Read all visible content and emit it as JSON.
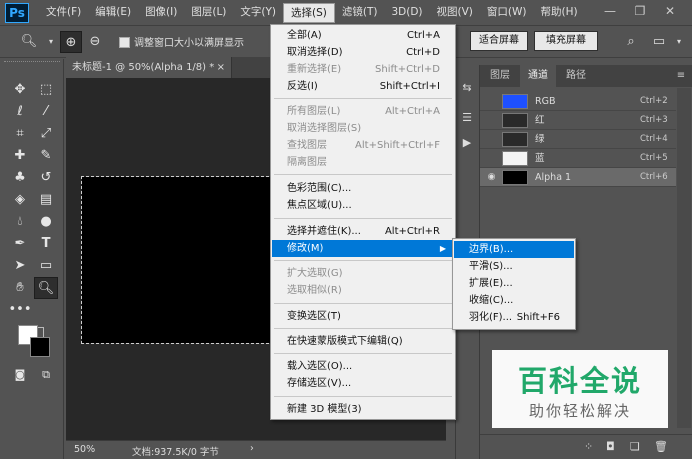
{
  "app": {
    "logo": "Ps",
    "colors": {
      "menu_highlight": "#0078d7",
      "ui_bg": "#535353",
      "watermark_green": "#21a86a"
    }
  },
  "menubar": {
    "items": [
      "文件(F)",
      "编辑(E)",
      "图像(I)",
      "图层(L)",
      "文字(Y)",
      "选择(S)",
      "滤镜(T)",
      "3D(D)",
      "视图(V)",
      "窗口(W)",
      "帮助(H)"
    ],
    "window_controls": [
      "minimize-icon",
      "restore-icon",
      "close-icon"
    ]
  },
  "options_bar": {
    "checkbox1_label": "调整窗口大小以满屏显示",
    "fit_screen": "适合屏幕",
    "fill_screen": "填充屏幕"
  },
  "document": {
    "tab_title": "未标题-1 @ 50%(Alpha 1/8) *",
    "tab_close": "×",
    "zoom": "50%",
    "doc_info": "文档:937.5K/0 字节"
  },
  "select_menu": {
    "items": [
      {
        "label": "全部(A)",
        "shortcut": "Ctrl+A",
        "disabled": false
      },
      {
        "label": "取消选择(D)",
        "shortcut": "Ctrl+D",
        "disabled": false
      },
      {
        "label": "重新选择(E)",
        "shortcut": "Shift+Ctrl+D",
        "disabled": true
      },
      {
        "label": "反选(I)",
        "shortcut": "Shift+Ctrl+I",
        "disabled": false
      },
      {
        "label": "所有图层(L)",
        "shortcut": "Alt+Ctrl+A",
        "disabled": true
      },
      {
        "label": "取消选择图层(S)",
        "shortcut": "",
        "disabled": true
      },
      {
        "label": "查找图层",
        "shortcut": "Alt+Shift+Ctrl+F",
        "disabled": true
      },
      {
        "label": "隔离图层",
        "shortcut": "",
        "disabled": true
      },
      {
        "label": "色彩范围(C)...",
        "shortcut": "",
        "disabled": false
      },
      {
        "label": "焦点区域(U)...",
        "shortcut": "",
        "disabled": false
      },
      {
        "label": "选择并遮住(K)...",
        "shortcut": "Alt+Ctrl+R",
        "disabled": false
      },
      {
        "label": "修改(M)",
        "shortcut": "",
        "disabled": false,
        "highlighted": true,
        "submenu": true
      },
      {
        "label": "扩大选取(G)",
        "shortcut": "",
        "disabled": true
      },
      {
        "label": "选取相似(R)",
        "shortcut": "",
        "disabled": true
      },
      {
        "label": "变换选区(T)",
        "shortcut": "",
        "disabled": false
      },
      {
        "label": "在快速蒙版模式下编辑(Q)",
        "shortcut": "",
        "disabled": false
      },
      {
        "label": "载入选区(O)...",
        "shortcut": "",
        "disabled": false
      },
      {
        "label": "存储选区(V)...",
        "shortcut": "",
        "disabled": false
      },
      {
        "label": "新建 3D 模型(3)",
        "shortcut": "",
        "disabled": false
      }
    ]
  },
  "modify_submenu": {
    "items": [
      {
        "label": "边界(B)...",
        "shortcut": "",
        "highlighted": true
      },
      {
        "label": "平滑(S)...",
        "shortcut": ""
      },
      {
        "label": "扩展(E)...",
        "shortcut": ""
      },
      {
        "label": "收缩(C)...",
        "shortcut": ""
      },
      {
        "label": "羽化(F)...",
        "shortcut": "Shift+F6"
      }
    ]
  },
  "channels_panel": {
    "tabs": [
      "图层",
      "通道",
      "路径"
    ],
    "active_tab": "通道",
    "rows": [
      {
        "name": "RGB",
        "shortcut": "Ctrl+2",
        "thumb_color": "#1e50ff"
      },
      {
        "name": "红",
        "shortcut": "Ctrl+3",
        "thumb_color": "#2a2a2a"
      },
      {
        "name": "绿",
        "shortcut": "Ctrl+4",
        "thumb_color": "#2a2a2a"
      },
      {
        "name": "蓝",
        "shortcut": "Ctrl+5",
        "thumb_color": "#f4f4f4"
      },
      {
        "name": "Alpha 1",
        "shortcut": "Ctrl+6",
        "thumb_color": "#000000",
        "selected": true,
        "visible": true
      }
    ]
  },
  "watermark": {
    "title": "百科全说",
    "subtitle": "助你轻松解决"
  }
}
